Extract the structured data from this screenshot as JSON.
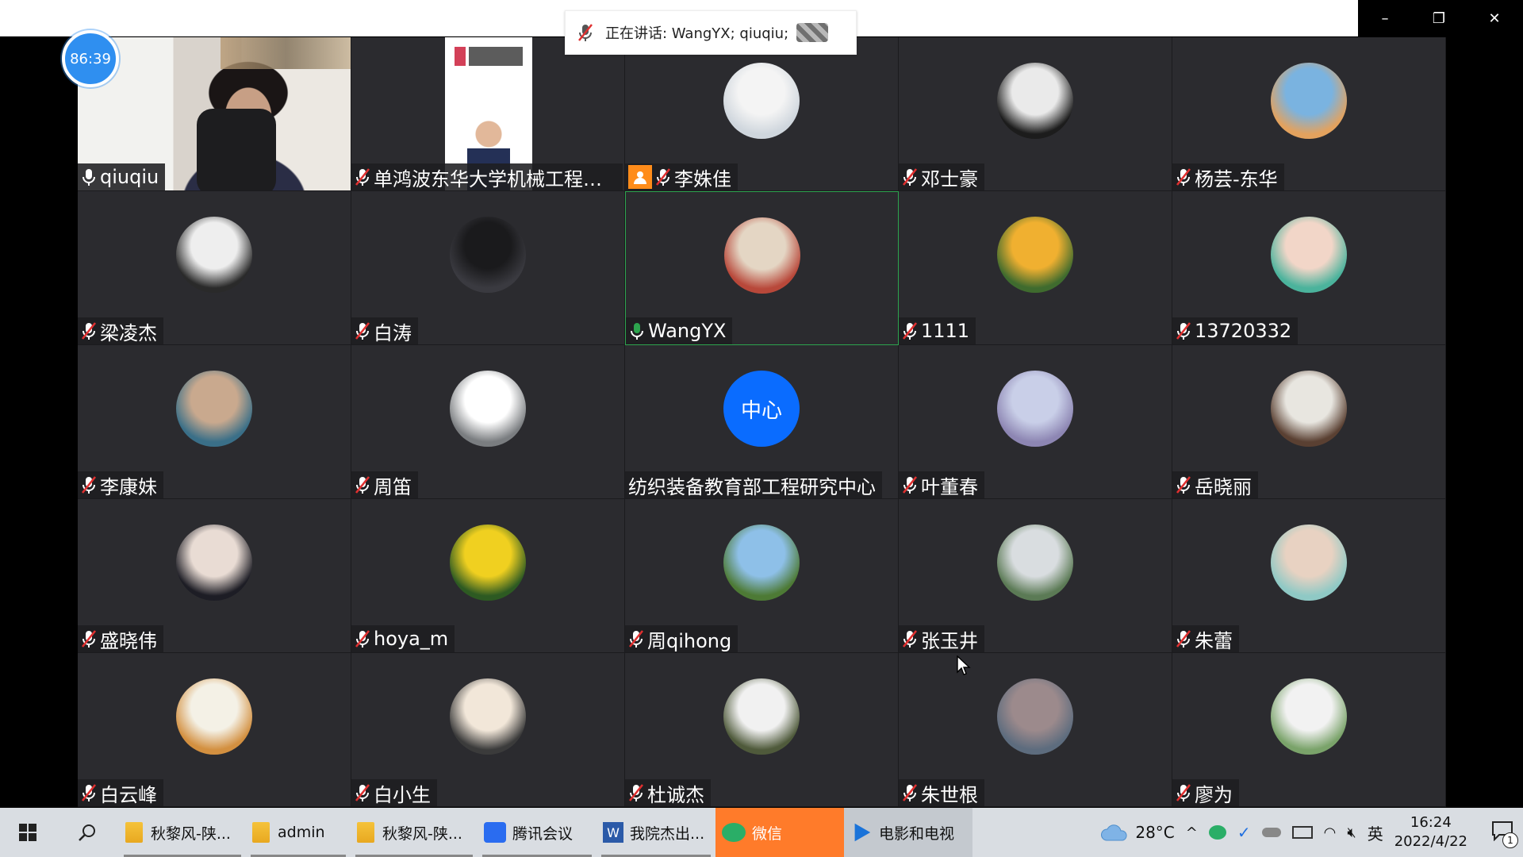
{
  "window": {
    "speaking_label": "正在讲话: WangYX; qiuqiu;",
    "timer": "86:39",
    "controls": {
      "minimize": "–",
      "restore": "❐",
      "close": "✕"
    }
  },
  "participants": [
    {
      "name": "qiuqiu",
      "mic": "on",
      "kind": "video"
    },
    {
      "name": "单鸿波东华大学机械工程学...",
      "mic": "muted",
      "kind": "doc"
    },
    {
      "name": "李姝佳",
      "mic": "muted",
      "kind": "avatar",
      "host": true,
      "avatar_colors": [
        "#f4f4f4",
        "#cfd6dd"
      ]
    },
    {
      "name": "邓士豪",
      "mic": "muted",
      "kind": "avatar",
      "avatar_colors": [
        "#eaeaea",
        "#1c1c1c"
      ]
    },
    {
      "name": "杨芸-东华",
      "mic": "muted",
      "kind": "avatar",
      "avatar_colors": [
        "#7ab3e0",
        "#e3a25e"
      ]
    },
    {
      "name": "梁凌杰",
      "mic": "muted",
      "kind": "avatar",
      "avatar_colors": [
        "#eeeeee",
        "#2a2a2a"
      ]
    },
    {
      "name": "白涛",
      "mic": "muted",
      "kind": "avatar",
      "avatar_colors": [
        "#1a1a1c",
        "#3a3a40"
      ]
    },
    {
      "name": "WangYX",
      "mic": "speaking",
      "kind": "avatar",
      "active": true,
      "avatar_colors": [
        "#e4d6c4",
        "#b8483a"
      ]
    },
    {
      "name": "1111",
      "mic": "muted",
      "kind": "avatar",
      "avatar_colors": [
        "#f0b030",
        "#3f6b2e"
      ]
    },
    {
      "name": "13720332",
      "mic": "muted",
      "kind": "avatar",
      "avatar_colors": [
        "#f2d6c8",
        "#4bb39c"
      ]
    },
    {
      "name": "李康妹",
      "mic": "muted",
      "kind": "avatar",
      "avatar_colors": [
        "#c9a98e",
        "#3a6f88"
      ]
    },
    {
      "name": "周笛",
      "mic": "muted",
      "kind": "avatar",
      "avatar_colors": [
        "#ffffff",
        "#7a7d80"
      ]
    },
    {
      "name": "纺织装备教育部工程研究中心",
      "mic": "none",
      "kind": "text-avatar",
      "avatar_text": "中心"
    },
    {
      "name": "叶董春",
      "mic": "muted",
      "kind": "avatar",
      "avatar_colors": [
        "#c9cfe8",
        "#8d86b3"
      ]
    },
    {
      "name": "岳晓丽",
      "mic": "muted",
      "kind": "avatar",
      "avatar_colors": [
        "#e8e6e0",
        "#5a4032"
      ]
    },
    {
      "name": "盛晓伟",
      "mic": "muted",
      "kind": "avatar",
      "avatar_colors": [
        "#e9dcd4",
        "#1d1d25"
      ]
    },
    {
      "name": "hoya_m",
      "mic": "muted",
      "kind": "avatar",
      "avatar_colors": [
        "#f0d020",
        "#2d5a22"
      ]
    },
    {
      "name": "周qihong",
      "mic": "muted",
      "kind": "avatar",
      "avatar_colors": [
        "#8ec0e8",
        "#4d7a35"
      ]
    },
    {
      "name": "张玉井",
      "mic": "muted",
      "kind": "avatar",
      "avatar_colors": [
        "#d9dde0",
        "#5b7a55"
      ]
    },
    {
      "name": "朱蕾",
      "mic": "muted",
      "kind": "avatar",
      "avatar_colors": [
        "#e8d2c2",
        "#8fc9c5"
      ]
    },
    {
      "name": "白云峰",
      "mic": "muted",
      "kind": "avatar",
      "avatar_colors": [
        "#f4f1e6",
        "#d39040"
      ]
    },
    {
      "name": "白小生",
      "mic": "muted",
      "kind": "avatar",
      "avatar_colors": [
        "#f2e7d9",
        "#3b3b3b"
      ]
    },
    {
      "name": "杜诚杰",
      "mic": "muted",
      "kind": "avatar",
      "avatar_colors": [
        "#f1f1f1",
        "#4f5a3b"
      ]
    },
    {
      "name": "朱世根",
      "mic": "muted",
      "kind": "avatar",
      "avatar_colors": [
        "#9c8a8c",
        "#5d6c7e"
      ]
    },
    {
      "name": "廖为",
      "mic": "muted",
      "kind": "avatar",
      "avatar_colors": [
        "#f2f2f2",
        "#7aa36a"
      ]
    }
  ],
  "taskbar": {
    "apps": [
      {
        "label": "秋黎风-陕...",
        "icon": "folder-icon",
        "state": "open"
      },
      {
        "label": "admin",
        "icon": "folder-icon",
        "state": "open"
      },
      {
        "label": "秋黎风-陕...",
        "icon": "folder-icon",
        "state": "open"
      },
      {
        "label": "腾讯会议",
        "icon": "tencent-meeting-icon",
        "state": "open"
      },
      {
        "label": "我院杰出...",
        "icon": "word-icon",
        "state": "open"
      },
      {
        "label": "微信",
        "icon": "wechat-icon",
        "state": "flash"
      },
      {
        "label": "电影和电视",
        "icon": "movies-tv-icon",
        "state": "active"
      }
    ],
    "weather": "28°C",
    "ime": "英",
    "time": "16:24",
    "date": "2022/4/22",
    "notifications": "1"
  },
  "colors": {
    "accent": "#2f8ff0",
    "tile_bg": "#2b2b2f",
    "speaking": "#2da44e",
    "wechat": "#ff7b2a"
  }
}
